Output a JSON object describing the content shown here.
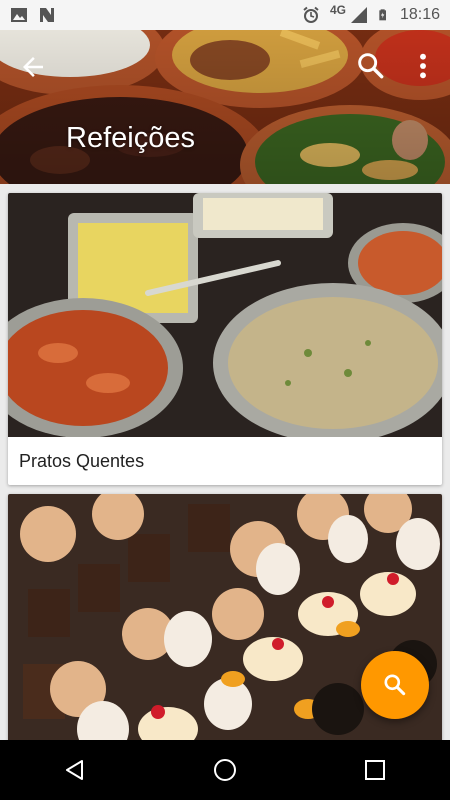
{
  "status_bar": {
    "time": "18:16",
    "network": "4G",
    "icons": [
      "image-icon",
      "n-icon",
      "alarm-icon",
      "signal-icon",
      "battery-icon"
    ]
  },
  "header": {
    "title": "Refeições",
    "icons": [
      "back-arrow-icon",
      "search-icon",
      "more-vert-icon"
    ]
  },
  "cards": [
    {
      "title": "Pratos Quentes",
      "image": "buffet-hot-dishes"
    },
    {
      "title": "",
      "image": "pastries-desserts"
    }
  ],
  "fab": {
    "icon": "search-icon",
    "color": "#ff9800"
  },
  "nav_bar": {
    "icons": [
      "back-triangle-icon",
      "home-circle-icon",
      "recents-square-icon"
    ]
  }
}
